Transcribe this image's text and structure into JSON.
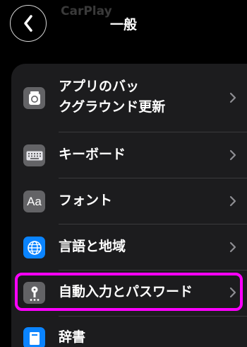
{
  "nav": {
    "faded_title": "CarPlay",
    "title": "一般"
  },
  "rows": [
    {
      "label": "アプリのバッ\nクグラウンド更新",
      "icon": "background-refresh-icon"
    },
    {
      "label": "キーボード",
      "icon": "keyboard-icon"
    },
    {
      "label": "フォント",
      "icon": "fonts-icon",
      "icon_text": "Aa"
    },
    {
      "label": "言語と地域",
      "icon": "globe-icon"
    },
    {
      "label": "自動入力とパスワード",
      "icon": "autofill-passwords-icon"
    },
    {
      "label": "辞書",
      "icon": "dictionary-icon"
    }
  ],
  "colors": {
    "highlight": "#ff00ff",
    "globe_blue": "#0a84ff",
    "gray_icon": "#636366"
  }
}
